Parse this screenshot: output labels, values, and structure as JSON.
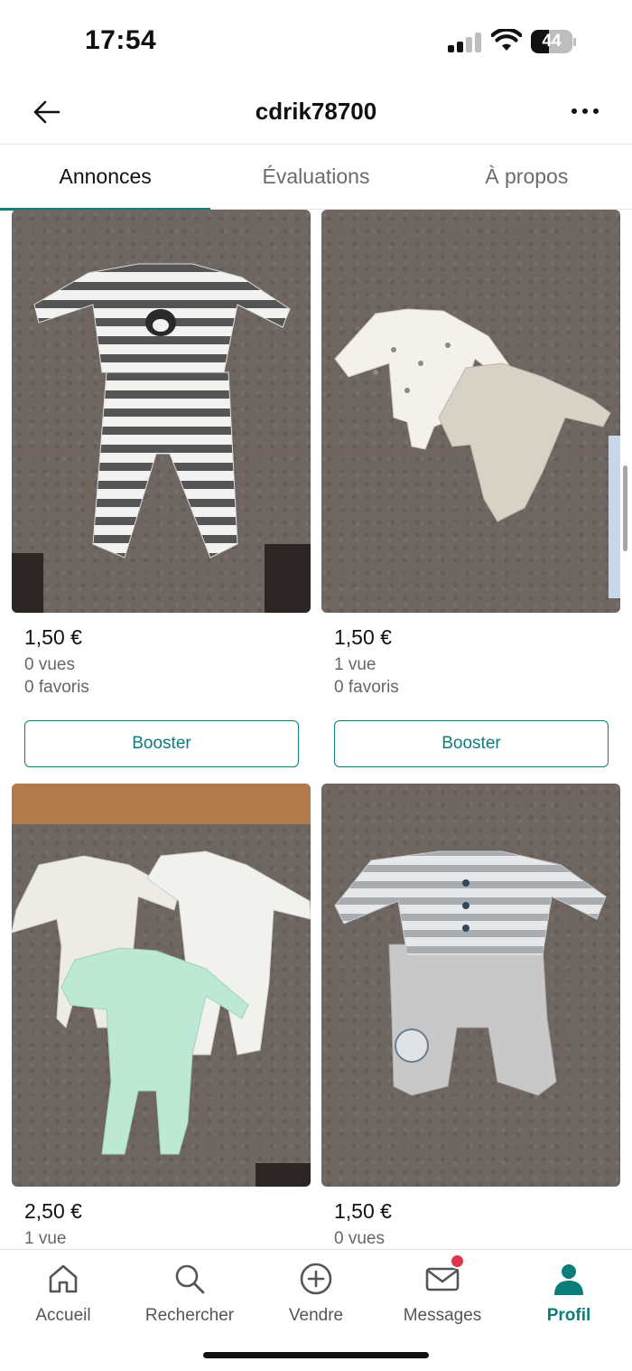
{
  "status": {
    "time": "17:54",
    "battery": "44",
    "battery_level": 0.44
  },
  "header": {
    "title": "cdrik78700"
  },
  "tabs": [
    {
      "label": "Annonces",
      "active": true
    },
    {
      "label": "Évaluations",
      "active": false
    },
    {
      "label": "À propos",
      "active": false
    }
  ],
  "items": [
    {
      "price": "1,50 €",
      "views": "0 vues",
      "favorites": "0 favoris",
      "boost_label": "Booster"
    },
    {
      "price": "1,50 €",
      "views": "1 vue",
      "favorites": "0 favoris",
      "boost_label": "Booster"
    },
    {
      "price": "2,50 €",
      "views": "1 vue"
    },
    {
      "price": "1,50 €",
      "views": "0 vues"
    }
  ],
  "nav": [
    {
      "label": "Accueil",
      "icon": "home-icon"
    },
    {
      "label": "Rechercher",
      "icon": "search-icon"
    },
    {
      "label": "Vendre",
      "icon": "plus-circle-icon"
    },
    {
      "label": "Messages",
      "icon": "envelope-icon",
      "has_badge": true
    },
    {
      "label": "Profil",
      "icon": "person-icon",
      "active": true
    }
  ],
  "colors": {
    "accent": "#0b7d7a",
    "badge": "#e0344a",
    "carpet": "#6f6661"
  }
}
